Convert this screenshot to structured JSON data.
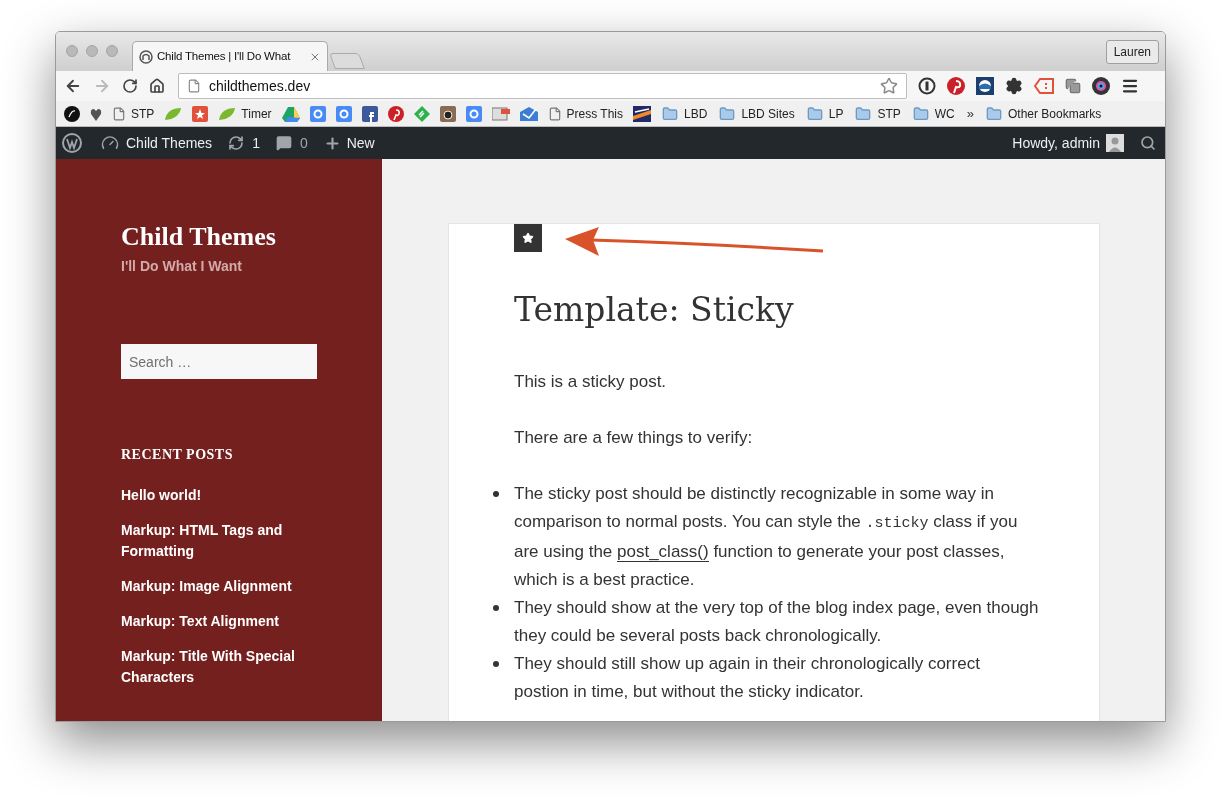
{
  "browser": {
    "tabs": [
      {
        "title": "Child Themes | I'll Do What",
        "selected": true
      }
    ],
    "profile_button": "Lauren",
    "url": "childthemes.dev",
    "bookmarks": [
      {
        "kind": "icon"
      },
      {
        "kind": "icon"
      },
      {
        "kind": "page",
        "label": "STP"
      },
      {
        "kind": "icon"
      },
      {
        "kind": "icon"
      },
      {
        "kind": "leaf",
        "label": "Timer"
      },
      {
        "kind": "icon"
      },
      {
        "kind": "icon"
      },
      {
        "kind": "icon"
      },
      {
        "kind": "icon"
      },
      {
        "kind": "icon"
      },
      {
        "kind": "icon"
      },
      {
        "kind": "icon"
      },
      {
        "kind": "icon"
      },
      {
        "kind": "icon"
      },
      {
        "kind": "icon"
      },
      {
        "kind": "page",
        "label": "Press This"
      },
      {
        "kind": "icon"
      },
      {
        "kind": "folder",
        "label": "LBD"
      },
      {
        "kind": "folder",
        "label": "LBD Sites"
      },
      {
        "kind": "folder",
        "label": "LP"
      },
      {
        "kind": "folder",
        "label": "STP"
      },
      {
        "kind": "folder",
        "label": "WC"
      },
      {
        "kind": "more",
        "label": "»"
      },
      {
        "kind": "folder",
        "label": "Other Bookmarks"
      }
    ]
  },
  "admin_bar": {
    "site": "Child Themes",
    "updates": "1",
    "comments": "0",
    "new": "New",
    "greeting": "Howdy, admin"
  },
  "sidebar": {
    "site_title": "Child Themes",
    "tagline": "I'll Do What I Want",
    "search": {
      "placeholder": "Search …"
    },
    "recent_heading": "RECENT POSTS",
    "recent_posts": [
      "Hello world!",
      "Markup: HTML Tags and Formatting",
      "Markup: Image Alignment",
      "Markup: Text Alignment",
      "Markup: Title With Special Characters"
    ]
  },
  "post": {
    "sticky": true,
    "title": "Template: Sticky",
    "paragraphs": [
      "This is a sticky post.",
      "There are a few things to verify:"
    ],
    "bullets": [
      [
        {
          "kind": "text",
          "text": "The sticky post should be distinctly recognizable in some way in comparison to normal posts. You can style the "
        },
        {
          "kind": "code",
          "text": ".sticky"
        },
        {
          "kind": "text",
          "text": " class if you are using the "
        },
        {
          "kind": "link",
          "text": "post_class()"
        },
        {
          "kind": "text",
          "text": " function to generate your post classes, which is a best practice."
        }
      ],
      [
        {
          "kind": "text",
          "text": "They should show at the very top of the blog index page, even though they could be several posts back chronologically."
        }
      ],
      [
        {
          "kind": "text",
          "text": "They should still show up again in their chronologically correct postion in time, but without the sticky indicator."
        }
      ]
    ]
  }
}
